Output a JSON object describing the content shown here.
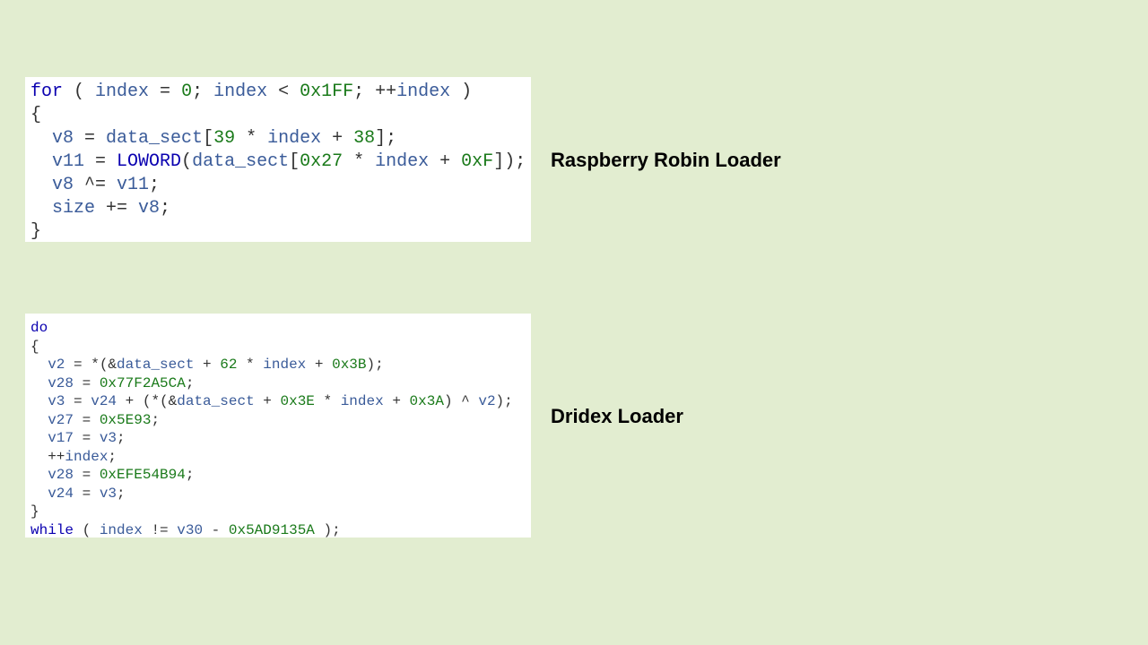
{
  "label1": "Raspberry Robin Loader",
  "label2": "Dridex Loader",
  "code1": {
    "l1_kw": "for",
    "l1_sp1": " ( ",
    "l1_id1": "index",
    "l1_op1": " = ",
    "l1_num1": "0",
    "l1_sep1": "; ",
    "l1_id2": "index",
    "l1_op2": " < ",
    "l1_num2": "0x1FF",
    "l1_sep2": "; ++",
    "l1_id3": "index",
    "l1_sp2": " )",
    "l2": "{",
    "l3_id1": "  v8",
    "l3_op1": " = ",
    "l3_id2": "data_sect",
    "l3_pn1": "[",
    "l3_num1": "39",
    "l3_op2": " * ",
    "l3_id3": "index",
    "l3_op3": " + ",
    "l3_num2": "38",
    "l3_pn2": "];",
    "l4_id1": "  v11",
    "l4_op1": " = ",
    "l4_fn": "LOWORD",
    "l4_pn1": "(",
    "l4_id2": "data_sect",
    "l4_pn2": "[",
    "l4_num1": "0x27",
    "l4_op2": " * ",
    "l4_id3": "index",
    "l4_op3": " + ",
    "l4_num2": "0xF",
    "l4_pn3": "]);",
    "l5_id1": "  v8",
    "l5_op1": " ^= ",
    "l5_id2": "v11",
    "l5_pn": ";",
    "l6_id1": "  size",
    "l6_op1": " += ",
    "l6_id2": "v8",
    "l6_pn": ";",
    "l7": "}"
  },
  "code2": {
    "l1_kw": "do",
    "l2": "{",
    "l3_id1": "  v2",
    "l3_op1": " = *(&",
    "l3_id2": "data_sect",
    "l3_op2": " + ",
    "l3_num1": "62",
    "l3_op3": " * ",
    "l3_id3": "index",
    "l3_op4": " + ",
    "l3_num2": "0x3B",
    "l3_pn": ");",
    "l4_id1": "  v28",
    "l4_op1": " = ",
    "l4_num1": "0x77F2A5CA",
    "l4_pn": ";",
    "l5_id1": "  v3",
    "l5_op1": " = ",
    "l5_id2": "v24",
    "l5_op2": " + (*(&",
    "l5_id3": "data_sect",
    "l5_op3": " + ",
    "l5_num1": "0x3E",
    "l5_op4": " * ",
    "l5_id4": "index",
    "l5_op5": " + ",
    "l5_num2": "0x3A",
    "l5_op6": ") ^ ",
    "l5_id5": "v2",
    "l5_pn": ");",
    "l6_id1": "  v27",
    "l6_op1": " = ",
    "l6_num1": "0x5E93",
    "l6_pn": ";",
    "l7_id1": "  v17",
    "l7_op1": " = ",
    "l7_id2": "v3",
    "l7_pn": ";",
    "l8_op1": "  ++",
    "l8_id1": "index",
    "l8_pn": ";",
    "l9_id1": "  v28",
    "l9_op1": " = ",
    "l9_num1": "0xEFE54B94",
    "l9_pn": ";",
    "l10_id1": "  v24",
    "l10_op1": " = ",
    "l10_id2": "v3",
    "l10_pn": ";",
    "l11": "}",
    "l12_kw": "while",
    "l12_sp1": " ( ",
    "l12_id1": "index",
    "l12_op1": " != ",
    "l12_id2": "v30",
    "l12_op2": " - ",
    "l12_num1": "0x5AD9135A",
    "l12_sp2": " );"
  }
}
